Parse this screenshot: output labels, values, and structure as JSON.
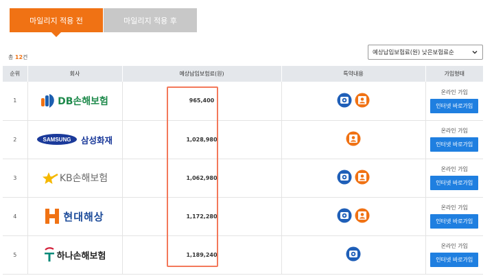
{
  "tabs": [
    {
      "label": "마일리지 적용 전",
      "active": true
    },
    {
      "label": "마일리지 적용 후",
      "active": false
    }
  ],
  "summary": {
    "prefix": "총 ",
    "count": "12",
    "suffix": "건"
  },
  "sort": {
    "selected": "예상납입보험료(원) 낮은보험료순"
  },
  "table": {
    "headers": [
      "순위",
      "회사",
      "예상납입보험료(원)",
      "특약내용",
      "가입형태"
    ],
    "rows": [
      {
        "rank": "1",
        "company": "DB손해보험",
        "logo_text": "DB손해보험",
        "premium": "965,400",
        "special_icons": [
          "blackbox-icon",
          "child-icon"
        ],
        "join_type": "온라인 가입",
        "button": "인터넷 바로가입"
      },
      {
        "rank": "2",
        "company": "삼성화재",
        "logo_text": "삼성화재",
        "logo_badge": "SAMSUNG",
        "premium": "1,028,980",
        "special_icons": [
          "child-icon"
        ],
        "join_type": "온라인 가입",
        "button": "인터넷 바로가입"
      },
      {
        "rank": "3",
        "company": "KB손해보험",
        "logo_text": "KB손해보험",
        "premium": "1,062,980",
        "special_icons": [
          "blackbox-icon",
          "child-icon"
        ],
        "join_type": "온라인 가입",
        "button": "인터넷 바로가입"
      },
      {
        "rank": "4",
        "company": "현대해상",
        "logo_text": "현대해상",
        "premium": "1,172,280",
        "special_icons": [
          "blackbox-icon",
          "child-icon"
        ],
        "join_type": "온라인 가입",
        "button": "인터넷 바로가입"
      },
      {
        "rank": "5",
        "company": "하나손해보험",
        "logo_text": "하나손해보험",
        "premium": "1,189,240",
        "special_icons": [
          "blackbox-icon"
        ],
        "join_type": "온라인 가입",
        "button": "인터넷 바로가입"
      }
    ]
  },
  "colors": {
    "accent": "#f07214",
    "button": "#1f7fe0",
    "blackbox_icon": "#1f5fb8",
    "child_icon": "#f07214",
    "highlight_box": "#f3785a"
  }
}
